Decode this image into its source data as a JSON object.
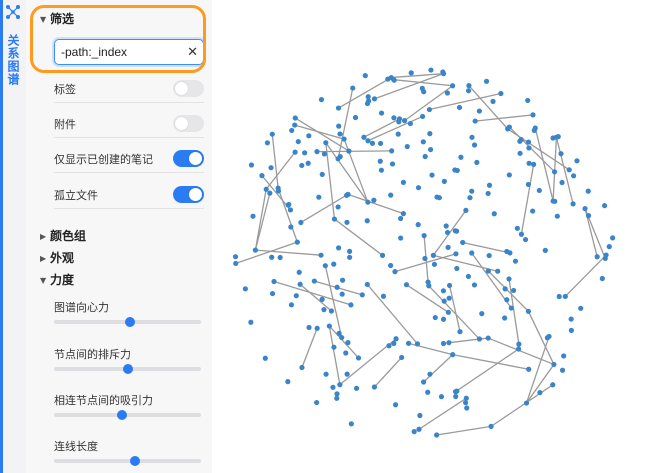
{
  "rail": {
    "label": "关系图谱",
    "icon": "graph-nodes-icon",
    "accent": "#2b7bf3"
  },
  "filter": {
    "title": "筛选",
    "search": {
      "value": "-path:_index",
      "placeholder": ""
    },
    "clear_icon": "close-icon",
    "options": [
      {
        "label": "标签",
        "on": false
      },
      {
        "label": "附件",
        "on": false
      },
      {
        "label": "仅显示已创建的笔记",
        "on": true
      },
      {
        "label": "孤立文件",
        "on": true
      }
    ]
  },
  "sections": {
    "groups": "颜色组",
    "display": "外观",
    "forces": "力度"
  },
  "forces": [
    {
      "label": "图谱向心力",
      "value": 0.52
    },
    {
      "label": "节点间的排斥力",
      "value": 0.5
    },
    {
      "label": "相连节点间的吸引力",
      "value": 0.46
    },
    {
      "label": "连线长度",
      "value": 0.55
    }
  ],
  "colors": {
    "node": "#3a84c9",
    "edge": "#9a9a9a",
    "highlight": "#ff9a1f"
  }
}
